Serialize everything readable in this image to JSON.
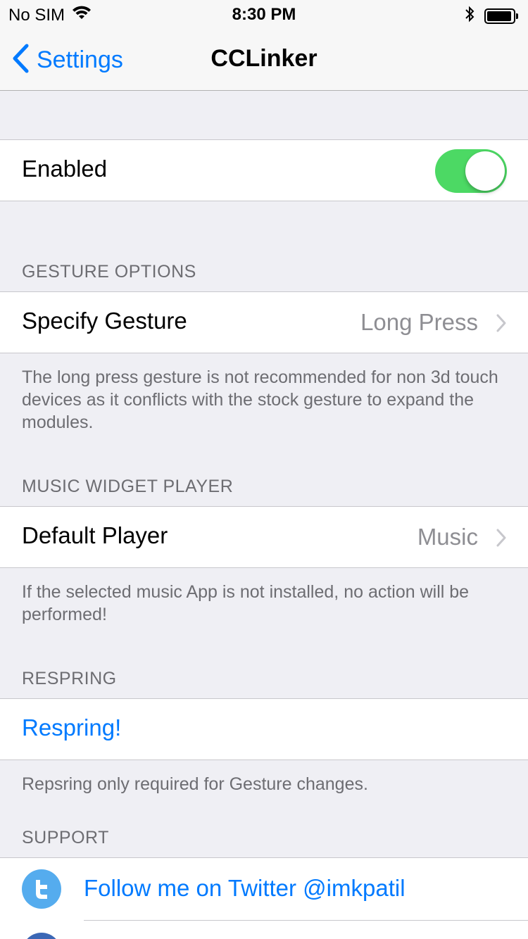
{
  "status_bar": {
    "carrier": "No SIM",
    "time": "8:30 PM",
    "battery_level": 0.95
  },
  "nav": {
    "back_label": "Settings",
    "title": "CCLinker"
  },
  "colors": {
    "accent": "#007aff",
    "toggle_on": "#4cd964",
    "twitter": "#55acee",
    "group_background": "#efeff4"
  },
  "enabled_cell": {
    "label": "Enabled",
    "on": true
  },
  "gesture_section": {
    "header": "GESTURE OPTIONS",
    "row_label": "Specify Gesture",
    "row_value": "Long Press",
    "footer": "The long press gesture is not recommended for non 3d touch devices as it conflicts with the stock gesture to expand the modules."
  },
  "music_section": {
    "header": "MUSIC WIDGET PLAYER",
    "row_label": "Default Player",
    "row_value": "Music",
    "footer": "If the selected music App is not installed, no action will be performed!"
  },
  "respring_section": {
    "header": "RESPRING",
    "button_label": "Respring!",
    "footer": "Repsring only required for Gesture changes."
  },
  "support_section": {
    "header": "SUPPORT",
    "twitter_label": "Follow me on Twitter @imkpatil",
    "icons": [
      "twitter-icon"
    ]
  }
}
